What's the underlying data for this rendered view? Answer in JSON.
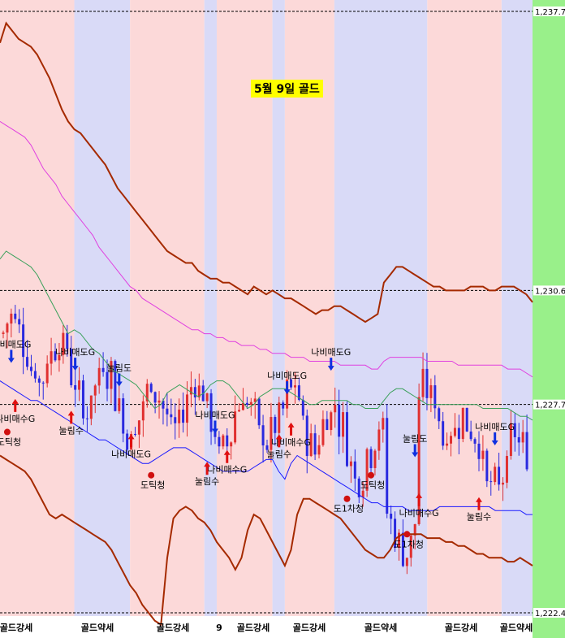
{
  "chart_data": {
    "type": "candlestick",
    "title": "5월 9일 골드",
    "y_axis": {
      "side": "right",
      "ticks": [
        1237.7,
        1230.6,
        1227.7,
        1222.4
      ],
      "tick_labels": [
        "1,237.7",
        "1,230.6",
        "1,227.7",
        "1,222.4"
      ],
      "range": [
        1222.4,
        1237.7
      ]
    },
    "session_bands": [
      {
        "label": "골드강세",
        "color": "#fcd9d9",
        "from": 0,
        "to": 12
      },
      {
        "label": "골드약세",
        "color": "#d9daf7",
        "from": 12,
        "to": 21
      },
      {
        "label": "골드강세",
        "color": "#fcd9d9",
        "from": 21,
        "to": 33
      },
      {
        "label": "",
        "color": "#d9daf7",
        "from": 33,
        "to": 35
      },
      {
        "label": "골드강세",
        "color": "#fcd9d9",
        "from": 35,
        "to": 44
      },
      {
        "label": "",
        "color": "#d9daf7",
        "from": 44,
        "to": 46
      },
      {
        "label": "골드강세",
        "color": "#fcd9d9",
        "from": 46,
        "to": 54
      },
      {
        "label": "골드약세",
        "color": "#d9daf7",
        "from": 54,
        "to": 69
      },
      {
        "label": "골드강세",
        "color": "#fcd9d9",
        "from": 69,
        "to": 81
      },
      {
        "label": "골드약세",
        "color": "#d9daf7",
        "from": 81,
        "to": 87
      }
    ],
    "band_labels_bottom": [
      "골드강세",
      "골드약세",
      "골드강세",
      "9",
      "골드강세",
      "골드강세",
      "골드약세",
      "골드강세",
      "골드약세"
    ],
    "series": [
      {
        "name": "upper band",
        "color": "#a52a00",
        "values": [
          1236.9,
          1237.4,
          1237.2,
          1237.0,
          1236.9,
          1236.8,
          1236.6,
          1236.3,
          1236.0,
          1235.6,
          1235.2,
          1234.9,
          1234.7,
          1234.6,
          1234.4,
          1234.2,
          1234.0,
          1233.8,
          1233.5,
          1233.2,
          1233.0,
          1232.8,
          1232.6,
          1232.4,
          1232.2,
          1232.0,
          1231.8,
          1231.6,
          1231.5,
          1231.4,
          1231.3,
          1231.3,
          1231.1,
          1231.0,
          1230.9,
          1230.9,
          1230.8,
          1230.8,
          1230.7,
          1230.6,
          1230.5,
          1230.7,
          1230.6,
          1230.5,
          1230.6,
          1230.5,
          1230.4,
          1230.4,
          1230.3,
          1230.2,
          1230.1,
          1230.0,
          1230.1,
          1230.1,
          1230.2,
          1230.2,
          1230.1,
          1230.0,
          1229.9,
          1229.8,
          1229.9,
          1230.0,
          1230.8,
          1231.0,
          1231.2,
          1231.2,
          1231.1,
          1231.0,
          1230.9,
          1230.8,
          1230.7,
          1230.7,
          1230.6,
          1230.6,
          1230.6,
          1230.6,
          1230.7,
          1230.7,
          1230.7,
          1230.6,
          1230.6,
          1230.7,
          1230.7,
          1230.7,
          1230.6,
          1230.5,
          1230.3
        ]
      },
      {
        "name": "upper 2",
        "color": "#e040e0",
        "values": [
          1234.9,
          1234.8,
          1234.7,
          1234.6,
          1234.5,
          1234.3,
          1234.0,
          1233.7,
          1233.5,
          1233.3,
          1233.0,
          1232.8,
          1232.6,
          1232.4,
          1232.2,
          1232.0,
          1231.7,
          1231.5,
          1231.3,
          1231.1,
          1230.9,
          1230.7,
          1230.6,
          1230.4,
          1230.3,
          1230.2,
          1230.1,
          1230.0,
          1229.9,
          1229.8,
          1229.7,
          1229.6,
          1229.6,
          1229.5,
          1229.5,
          1229.4,
          1229.4,
          1229.3,
          1229.3,
          1229.2,
          1229.2,
          1229.2,
          1229.1,
          1229.1,
          1229.0,
          1229.0,
          1229.0,
          1228.9,
          1228.9,
          1228.9,
          1228.8,
          1228.8,
          1228.8,
          1228.8,
          1228.8,
          1228.7,
          1228.7,
          1228.7,
          1228.7,
          1228.7,
          1228.6,
          1228.6,
          1228.8,
          1228.9,
          1228.9,
          1228.9,
          1228.9,
          1228.9,
          1228.9,
          1228.8,
          1228.8,
          1228.8,
          1228.8,
          1228.8,
          1228.7,
          1228.7,
          1228.7,
          1228.7,
          1228.7,
          1228.7,
          1228.7,
          1228.7,
          1228.6,
          1228.6,
          1228.6,
          1228.5,
          1228.4
        ]
      },
      {
        "name": "middle",
        "color": "#3aa05a",
        "values": [
          1231.4,
          1231.6,
          1231.5,
          1231.4,
          1231.3,
          1231.2,
          1231.0,
          1230.7,
          1230.4,
          1230.1,
          1229.8,
          1229.5,
          1229.6,
          1229.5,
          1229.3,
          1229.1,
          1229.0,
          1228.8,
          1228.6,
          1228.5,
          1228.4,
          1228.3,
          1228.2,
          1228.0,
          1227.8,
          1227.6,
          1227.7,
          1228.0,
          1228.1,
          1228.2,
          1228.1,
          1228.0,
          1227.9,
          1228.0,
          1228.2,
          1228.3,
          1228.3,
          1228.2,
          1228.0,
          1227.8,
          1227.6,
          1227.7,
          1227.9,
          1228.0,
          1228.1,
          1228.1,
          1228.1,
          1228.0,
          1227.9,
          1227.8,
          1227.7,
          1227.7,
          1227.8,
          1227.8,
          1227.8,
          1227.8,
          1227.8,
          1227.7,
          1227.7,
          1227.6,
          1227.6,
          1227.6,
          1227.8,
          1228.0,
          1228.1,
          1228.1,
          1228.0,
          1227.9,
          1227.8,
          1227.7,
          1227.7,
          1227.7,
          1227.7,
          1227.7,
          1227.7,
          1227.7,
          1227.7,
          1227.7,
          1227.6,
          1227.6,
          1227.6,
          1227.6,
          1227.6,
          1227.5,
          1227.4,
          1227.4,
          1227.3
        ]
      },
      {
        "name": "lower band",
        "color": "#a52a00",
        "values": [
          1226.4,
          1226.3,
          1226.2,
          1226.1,
          1226.0,
          1225.8,
          1225.5,
          1225.2,
          1224.9,
          1224.8,
          1224.9,
          1224.8,
          1224.7,
          1224.6,
          1224.5,
          1224.4,
          1224.3,
          1224.2,
          1224.0,
          1223.7,
          1223.4,
          1223.1,
          1222.9,
          1222.6,
          1222.4,
          1222.2,
          1222.1,
          1223.8,
          1224.8,
          1225.0,
          1225.1,
          1225.0,
          1224.8,
          1224.7,
          1224.5,
          1224.2,
          1224.0,
          1223.8,
          1223.5,
          1223.8,
          1224.5,
          1224.9,
          1224.8,
          1224.5,
          1224.2,
          1223.9,
          1223.6,
          1224.0,
          1224.9,
          1225.3,
          1225.3,
          1225.2,
          1225.1,
          1225.0,
          1224.9,
          1224.8,
          1224.6,
          1224.4,
          1224.2,
          1224.0,
          1223.9,
          1223.8,
          1223.8,
          1224.0,
          1224.3,
          1224.4,
          1224.4,
          1224.4,
          1224.4,
          1224.3,
          1224.3,
          1224.3,
          1224.2,
          1224.2,
          1224.1,
          1224.1,
          1224.0,
          1223.9,
          1223.9,
          1223.8,
          1223.8,
          1223.8,
          1223.7,
          1223.7,
          1223.8,
          1223.7,
          1223.6
        ]
      },
      {
        "name": "signal line",
        "color": "#1a1aff",
        "values": [
          1228.3,
          1228.2,
          1228.1,
          1228.0,
          1227.9,
          1227.8,
          1227.8,
          1227.7,
          1227.6,
          1227.5,
          1227.4,
          1227.3,
          1227.2,
          1227.1,
          1227.0,
          1226.9,
          1226.8,
          1226.8,
          1226.7,
          1226.6,
          1226.5,
          1226.4,
          1226.3,
          1226.2,
          1226.2,
          1226.3,
          1226.4,
          1226.5,
          1226.6,
          1226.6,
          1226.6,
          1226.5,
          1226.4,
          1226.3,
          1226.2,
          1226.1,
          1226.0,
          1226.0,
          1226.0,
          1226.0,
          1226.0,
          1226.1,
          1226.2,
          1226.3,
          1226.3,
          1226.0,
          1225.8,
          1226.2,
          1226.4,
          1226.3,
          1226.2,
          1226.1,
          1226.0,
          1225.9,
          1225.8,
          1225.7,
          1225.6,
          1225.5,
          1225.4,
          1225.3,
          1225.2,
          1225.2,
          1225.1,
          1225.1,
          1225.1,
          1225.1,
          1225.0,
          1225.0,
          1225.0,
          1225.0,
          1225.0,
          1225.1,
          1225.1,
          1225.1,
          1225.1,
          1225.1,
          1225.1,
          1225.1,
          1225.1,
          1225.1,
          1225.0,
          1225.0,
          1225.0,
          1225.0,
          1225.0,
          1224.9,
          1224.9
        ]
      }
    ],
    "annotations": [
      {
        "text": "나비매도G",
        "type": "sell",
        "i": 2,
        "price": 1228.8
      },
      {
        "text": "나비매수G",
        "type": "buy",
        "i": 3,
        "price": 1227.8
      },
      {
        "text": "도틱청",
        "type": "exit",
        "i": 1,
        "price": 1227.0
      },
      {
        "text": "나비매도G",
        "type": "sell",
        "i": 18,
        "price": 1228.6
      },
      {
        "text": "눌림수",
        "type": "buy",
        "i": 17,
        "price": 1227.5
      },
      {
        "text": "눌림도",
        "type": "sell",
        "i": 29,
        "price": 1228.2
      },
      {
        "text": "나비매도G",
        "type": "buy",
        "i": 32,
        "price": 1226.9
      },
      {
        "text": "도틱청",
        "type": "exit",
        "i": 37,
        "price": 1225.9
      },
      {
        "text": "나비매도G",
        "type": "sell",
        "i": 53,
        "price": 1227.0
      },
      {
        "text": "나비매수G",
        "type": "buy",
        "i": 56,
        "price": 1226.5
      },
      {
        "text": "눌림수",
        "type": "buy",
        "i": 51,
        "price": 1226.2
      },
      {
        "text": "나비매도G",
        "type": "sell",
        "i": 71,
        "price": 1228.0
      },
      {
        "text": "나비매수G",
        "type": "buy",
        "i": 72,
        "price": 1227.2
      },
      {
        "text": "눌림수",
        "type": "buy",
        "i": 69,
        "price": 1226.9
      },
      {
        "text": "나비매도G",
        "type": "sell",
        "i": 82,
        "price": 1228.6
      },
      {
        "text": "도1차청",
        "type": "exit",
        "i": 86,
        "price": 1225.3
      },
      {
        "text": "도틱청",
        "type": "exit",
        "i": 92,
        "price": 1225.9
      },
      {
        "text": "눌림도",
        "type": "sell",
        "i": 103,
        "price": 1226.4
      },
      {
        "text": "나비매수G",
        "type": "buy",
        "i": 104,
        "price": 1225.4
      },
      {
        "text": "도1차청",
        "type": "exit",
        "i": 101,
        "price": 1224.4
      },
      {
        "text": "나비매도G",
        "type": "sell",
        "i": 123,
        "price": 1226.7
      },
      {
        "text": "눌림수",
        "type": "buy",
        "i": 119,
        "price": 1225.3
      }
    ]
  },
  "colors": {
    "bull": "#e03030",
    "bear": "#2a2adf",
    "right_strip": "#99f08a",
    "axis_bg": "#ffffff"
  }
}
